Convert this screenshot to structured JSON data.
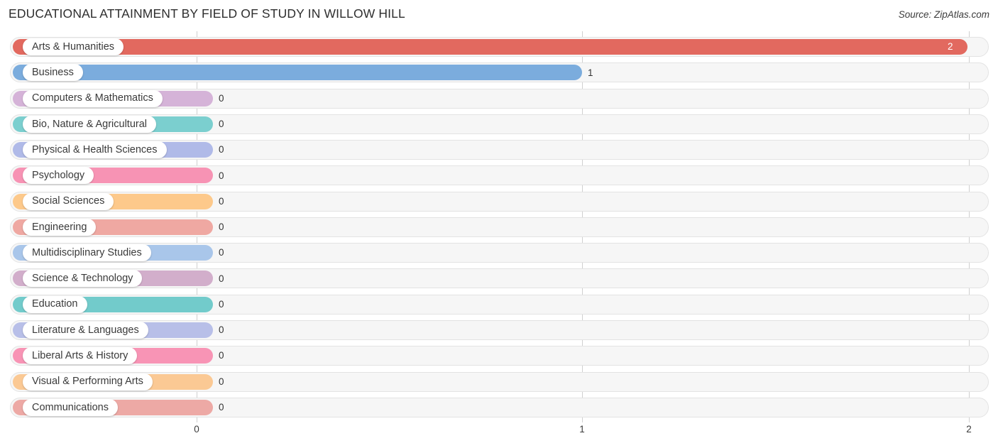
{
  "header": {
    "title": "EDUCATIONAL ATTAINMENT BY FIELD OF STUDY IN WILLOW HILL",
    "source": "Source: ZipAtlas.com"
  },
  "axis": {
    "ticks": [
      "0",
      "1",
      "2"
    ]
  },
  "chart_data": {
    "type": "bar",
    "orientation": "horizontal",
    "title": "EDUCATIONAL ATTAINMENT BY FIELD OF STUDY IN WILLOW HILL",
    "subtitle": "",
    "xlabel": "",
    "ylabel": "",
    "xlim": [
      0,
      2
    ],
    "xticks": [
      0,
      1,
      2
    ],
    "xtick_labels": [
      "0",
      "1",
      "2"
    ],
    "grid": true,
    "legend": false,
    "source": "Source: ZipAtlas.com",
    "categories": [
      "Arts & Humanities",
      "Business",
      "Computers & Mathematics",
      "Bio, Nature & Agricultural",
      "Physical & Health Sciences",
      "Psychology",
      "Social Sciences",
      "Engineering",
      "Multidisciplinary Studies",
      "Science & Technology",
      "Education",
      "Literature & Languages",
      "Liberal Arts & History",
      "Visual & Performing Arts",
      "Communications"
    ],
    "values": [
      2,
      1,
      0,
      0,
      0,
      0,
      0,
      0,
      0,
      0,
      0,
      0,
      0,
      0,
      0
    ],
    "value_labels": [
      "2",
      "1",
      "0",
      "0",
      "0",
      "0",
      "0",
      "0",
      "0",
      "0",
      "0",
      "0",
      "0",
      "0",
      "0"
    ],
    "colors": [
      "#e2695f",
      "#7bacdd",
      "#d5b3d8",
      "#7bcfcf",
      "#b0bae8",
      "#f793b4",
      "#fdc98b",
      "#efa8a2",
      "#a9c6ea",
      "#d2aecb",
      "#72cbcb",
      "#b8bfe8",
      "#f894b5",
      "#fbc994",
      "#eda9a5"
    ]
  },
  "rows": [
    {
      "label": "Arts & Humanities",
      "value": "2",
      "color": "#e2695f"
    },
    {
      "label": "Business",
      "value": "1",
      "color": "#7bacdd"
    },
    {
      "label": "Computers & Mathematics",
      "value": "0",
      "color": "#d5b3d8"
    },
    {
      "label": "Bio, Nature & Agricultural",
      "value": "0",
      "color": "#7bcfcf"
    },
    {
      "label": "Physical & Health Sciences",
      "value": "0",
      "color": "#b0bae8"
    },
    {
      "label": "Psychology",
      "value": "0",
      "color": "#f793b4"
    },
    {
      "label": "Social Sciences",
      "value": "0",
      "color": "#fdc98b"
    },
    {
      "label": "Engineering",
      "value": "0",
      "color": "#efa8a2"
    },
    {
      "label": "Multidisciplinary Studies",
      "value": "0",
      "color": "#a9c6ea"
    },
    {
      "label": "Science & Technology",
      "value": "0",
      "color": "#d2aecb"
    },
    {
      "label": "Education",
      "value": "0",
      "color": "#72cbcb"
    },
    {
      "label": "Literature & Languages",
      "value": "0",
      "color": "#b8bfe8"
    },
    {
      "label": "Liberal Arts & History",
      "value": "0",
      "color": "#f894b5"
    },
    {
      "label": "Visual & Performing Arts",
      "value": "0",
      "color": "#fbc994"
    },
    {
      "label": "Communications",
      "value": "0",
      "color": "#eda9a5"
    }
  ]
}
